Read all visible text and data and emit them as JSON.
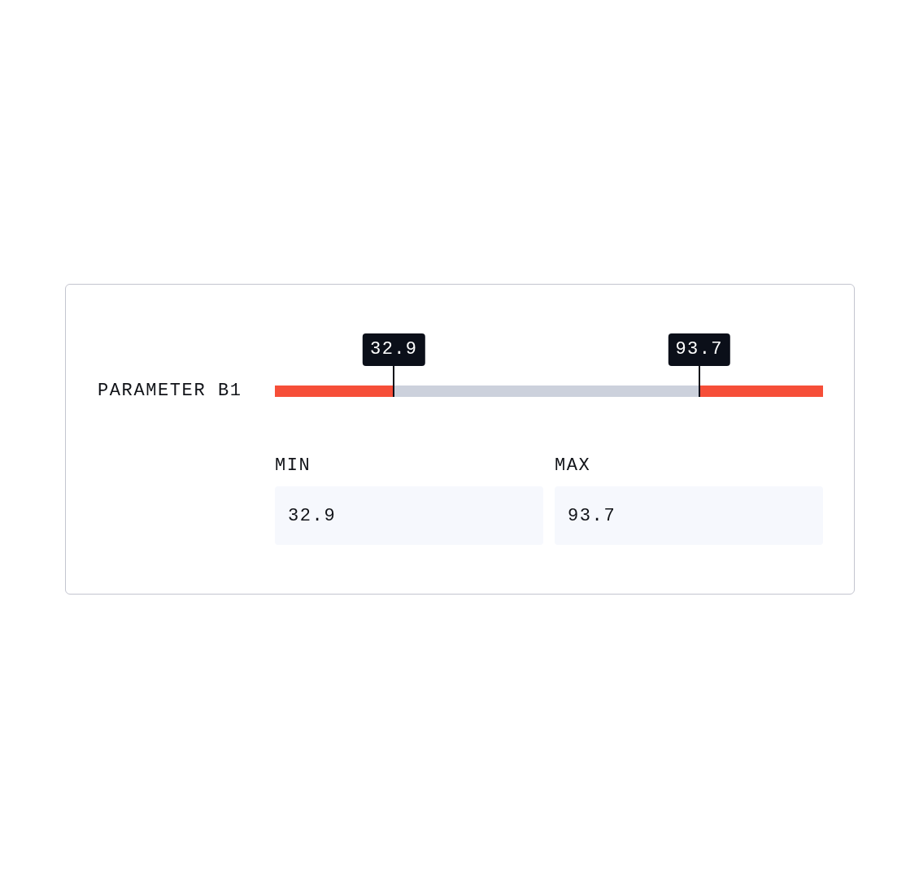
{
  "parameter": {
    "label": "PARAMETER B1"
  },
  "handles": [
    {
      "tooltip": "32.9",
      "level": 0.217
    },
    {
      "tooltip": "93.7",
      "level": 0.774
    }
  ],
  "fields": [
    {
      "label": "MIN",
      "value": "32.9"
    },
    {
      "label": "MAX",
      "value": "93.7"
    }
  ]
}
